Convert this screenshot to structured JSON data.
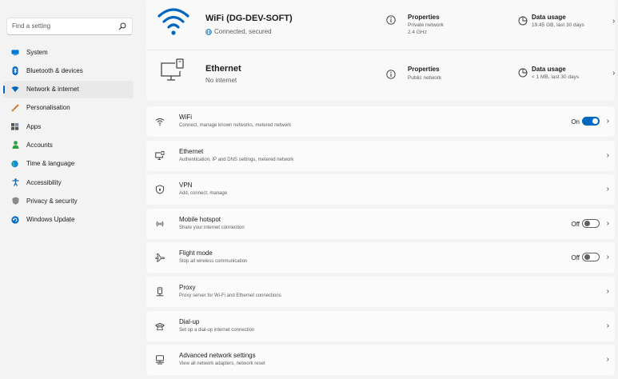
{
  "search": {
    "placeholder": "Find a setting"
  },
  "sidebar": {
    "items": [
      {
        "label": "System",
        "icon": "monitor-icon",
        "color": "#0078d4"
      },
      {
        "label": "Bluetooth & devices",
        "icon": "bluetooth-icon",
        "color": "#0067c0"
      },
      {
        "label": "Network & internet",
        "icon": "wifi-diamond-icon",
        "color": "#0067c0",
        "active": true
      },
      {
        "label": "Personalisation",
        "icon": "brush-icon",
        "color": "#c46a1a"
      },
      {
        "label": "Apps",
        "icon": "apps-icon",
        "color": "#444444"
      },
      {
        "label": "Accounts",
        "icon": "person-icon",
        "color": "#2ea043"
      },
      {
        "label": "Time & language",
        "icon": "globe-clock-icon",
        "color": "#0a8fd8"
      },
      {
        "label": "Accessibility",
        "icon": "accessibility-icon",
        "color": "#0067c0"
      },
      {
        "label": "Privacy & security",
        "icon": "shield-icon",
        "color": "#8a8a8a"
      },
      {
        "label": "Windows Update",
        "icon": "update-icon",
        "color": "#0067c0"
      }
    ]
  },
  "wifi": {
    "name": "WiFi (DG-DEV-SOFT)",
    "status": "Connected, secured",
    "properties_label": "Properties",
    "properties_line1": "Private network",
    "properties_line2": "2.4 GHz",
    "usage_label": "Data usage",
    "usage_detail": "19.45 GB, last 30 days"
  },
  "ethernet": {
    "name": "Ethernet",
    "status": "No internet",
    "properties_label": "Properties",
    "properties_line1": "Public network",
    "usage_label": "Data usage",
    "usage_detail": "< 1 MB, last 30 days"
  },
  "rows": [
    {
      "title": "WiFi",
      "subtitle": "Connect, manage known networks, metered network",
      "icon": "wifi-icon",
      "state": "On"
    },
    {
      "title": "Ethernet",
      "subtitle": "Authentication, IP and DNS settings, metered network",
      "icon": "ethernet-icon"
    },
    {
      "title": "VPN",
      "subtitle": "Add, connect, manage",
      "icon": "vpn-shield-icon"
    },
    {
      "title": "Mobile hotspot",
      "subtitle": "Share your internet connection",
      "icon": "hotspot-icon",
      "state": "Off"
    },
    {
      "title": "Flight mode",
      "subtitle": "Stop all wireless communication",
      "icon": "airplane-icon",
      "state": "Off"
    },
    {
      "title": "Proxy",
      "subtitle": "Proxy server for Wi-Fi and Ethernet connections",
      "icon": "proxy-icon"
    },
    {
      "title": "Dial-up",
      "subtitle": "Set up a dial-up internet connection",
      "icon": "dialup-icon"
    },
    {
      "title": "Advanced network settings",
      "subtitle": "View all network adapters, network reset",
      "icon": "advanced-network-icon"
    }
  ],
  "colors": {
    "accent": "#0067c0",
    "background": "#f3f3f3",
    "card": "#fbfbfb"
  }
}
